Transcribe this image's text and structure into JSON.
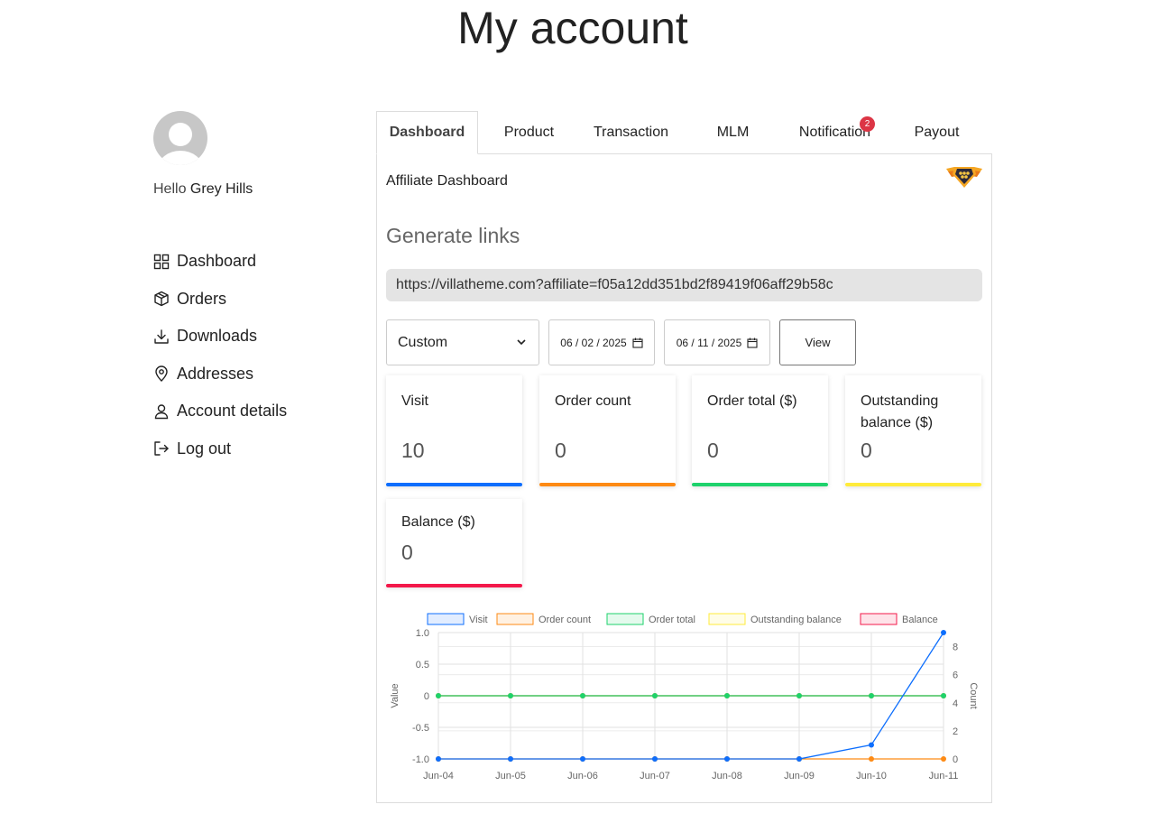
{
  "page": {
    "title": "My account"
  },
  "sidebar": {
    "hello": "Hello",
    "username": "Grey Hills",
    "items": [
      {
        "label": "Dashboard",
        "icon": "dashboard-grid-icon"
      },
      {
        "label": "Orders",
        "icon": "box-icon"
      },
      {
        "label": "Downloads",
        "icon": "download-icon"
      },
      {
        "label": "Addresses",
        "icon": "map-pin-icon"
      },
      {
        "label": "Account details",
        "icon": "user-icon"
      },
      {
        "label": "Log out",
        "icon": "logout-icon"
      }
    ]
  },
  "tabs": [
    {
      "label": "Dashboard",
      "active": true
    },
    {
      "label": "Product"
    },
    {
      "label": "Transaction"
    },
    {
      "label": "MLM"
    },
    {
      "label": "Notification",
      "badge": "2"
    },
    {
      "label": "Payout"
    }
  ],
  "panel": {
    "title": "Affiliate Dashboard",
    "generate_title": "Generate links",
    "link": "https://villatheme.com?affiliate=f05a12dd351bd2f89419f06aff29b58c",
    "range_select": "Custom",
    "date_from": "06 / 02 / 2025",
    "date_to": "06 / 11 / 2025",
    "view_button": "View"
  },
  "cards": [
    {
      "label": "Visit",
      "value": "10",
      "color": "#0d6efd"
    },
    {
      "label": "Order count",
      "value": "0",
      "color": "#fd8a14"
    },
    {
      "label": "Order total ($)",
      "value": "0",
      "color": "#1ed26c"
    },
    {
      "label": "Outstanding balance ($)",
      "value": "0",
      "color": "#ffeb3b"
    },
    {
      "label": "Balance ($)",
      "value": "0",
      "color": "#f3184a"
    }
  ],
  "chart_data": {
    "type": "line",
    "x": [
      "Jun-04",
      "Jun-05",
      "Jun-06",
      "Jun-07",
      "Jun-08",
      "Jun-09",
      "Jun-10",
      "Jun-11"
    ],
    "series": [
      {
        "name": "Visit",
        "color": "#0d6efd",
        "axis": "right",
        "values": [
          0,
          0,
          0,
          0,
          0,
          0,
          1,
          9
        ]
      },
      {
        "name": "Order count",
        "color": "#fd8a14",
        "axis": "right",
        "values": [
          0,
          0,
          0,
          0,
          0,
          0,
          0,
          0
        ]
      },
      {
        "name": "Order total",
        "color": "#1ed26c",
        "axis": "left",
        "values": [
          0,
          0,
          0,
          0,
          0,
          0,
          0,
          0
        ]
      },
      {
        "name": "Outstanding balance",
        "color": "#ffeb3b",
        "axis": "left",
        "values": [
          0,
          0,
          0,
          0,
          0,
          0,
          0,
          0
        ]
      },
      {
        "name": "Balance",
        "color": "#f3184a",
        "axis": "left",
        "values": [
          0,
          0,
          0,
          0,
          0,
          0,
          0,
          0
        ]
      }
    ],
    "ylabel": "Value",
    "y2label": "Count",
    "ylim": [
      -1,
      1
    ],
    "yticks": [
      "1.0",
      "0.5",
      "0",
      "-0.5",
      "-1.0"
    ],
    "y2lim": [
      0,
      9
    ],
    "y2ticks": [
      "8",
      "6",
      "4",
      "2",
      "0"
    ],
    "legend": "top",
    "grid": true
  }
}
